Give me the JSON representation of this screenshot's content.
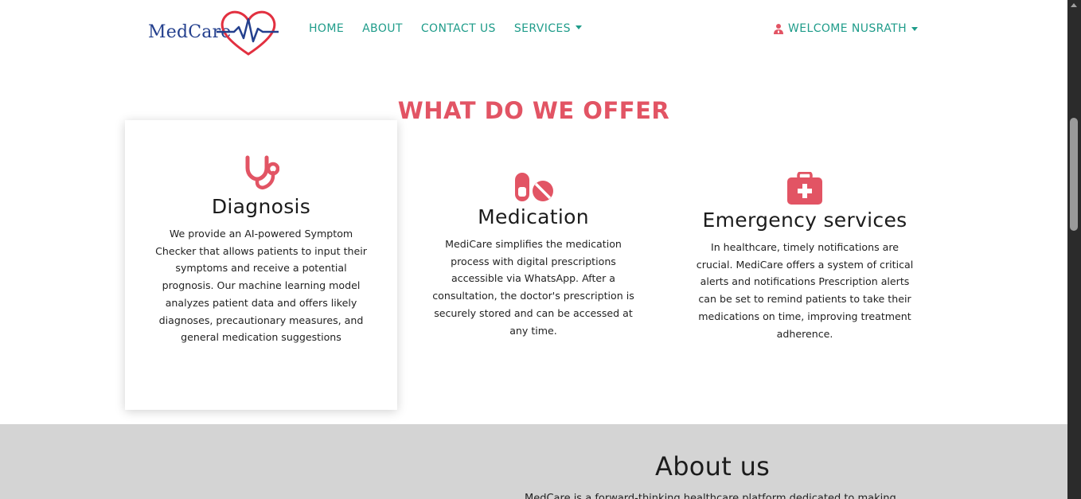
{
  "nav": {
    "logo_text": "MedCare",
    "links": [
      "HOME",
      "ABOUT",
      "CONTACT US",
      "SERVICES"
    ],
    "user_menu": "WELCOME NUSRATH"
  },
  "offer": {
    "title": "WHAT DO WE OFFER",
    "items": [
      {
        "icon": "stethoscope-icon",
        "title": "Diagnosis",
        "text": "We provide an AI-powered Symptom Checker that allows patients to input their symptoms and receive a potential prognosis. Our machine learning model analyzes patient data and offers likely diagnoses, precautionary measures, and general medication suggestions"
      },
      {
        "icon": "pills-icon",
        "title": "Medication",
        "text": "MediCare simplifies the medication process with digital prescriptions accessible via WhatsApp. After a consultation, the doctor's prescription is securely stored and can be accessed at any time."
      },
      {
        "icon": "first-aid-kit-icon",
        "title": "Emergency services",
        "text": "In healthcare, timely notifications are crucial. MediCare offers a system of critical alerts and notifications Prescription alerts can be set to remind patients to take their medications on time, improving treatment adherence."
      }
    ]
  },
  "about": {
    "title": "About us",
    "text": "MedCare is a forward-thinking healthcare platform dedicated to making"
  },
  "colors": {
    "accent": "#e25464",
    "link": "#1f9c8a",
    "logo_blue": "#24408e",
    "about_bg": "#d4d4d4"
  }
}
